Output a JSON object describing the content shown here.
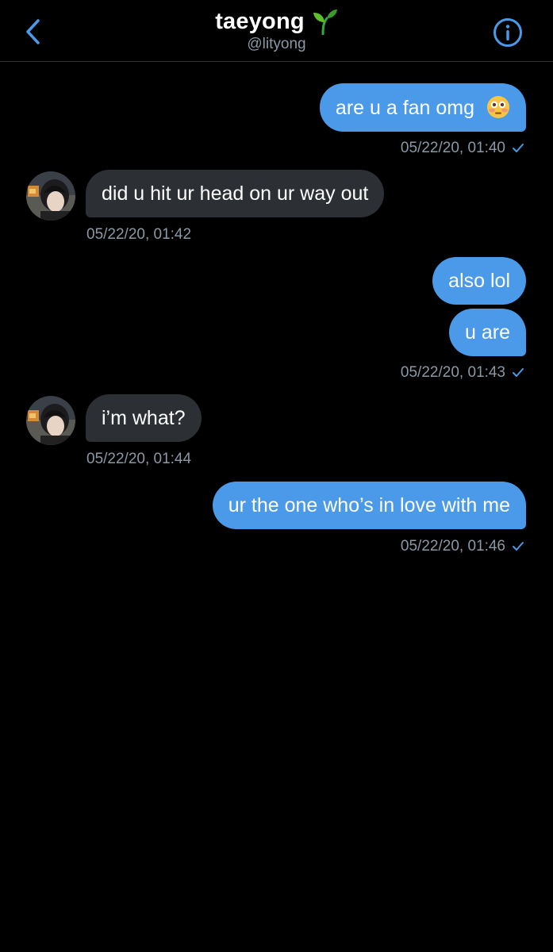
{
  "header": {
    "title": "taeyong",
    "handle": "@lityong",
    "title_emoji_icon": "seedling-icon"
  },
  "colors": {
    "background": "#000000",
    "accent": "#4a9ae9",
    "incoming_bubble": "#2c2f33",
    "timestamp": "#8b98a5"
  },
  "messages": [
    {
      "direction": "out",
      "text": "are u a fan omg",
      "emoji_icon": "flushed-face-icon"
    },
    {
      "direction": "in",
      "text": "did u hit ur head on ur way out"
    },
    {
      "direction": "out",
      "text": "also lol"
    },
    {
      "direction": "out",
      "text": "u are"
    },
    {
      "direction": "in",
      "text": "i’m what?"
    },
    {
      "direction": "out",
      "text": "ur the one who’s in love with me"
    }
  ],
  "timestamps": [
    {
      "text": "05/22/20, 01:40",
      "read": true
    },
    {
      "text": "05/22/20, 01:42",
      "read": false
    },
    {
      "text": "05/22/20, 01:43",
      "read": true
    },
    {
      "text": "05/22/20, 01:44",
      "read": false
    },
    {
      "text": "05/22/20, 01:46",
      "read": true
    }
  ]
}
